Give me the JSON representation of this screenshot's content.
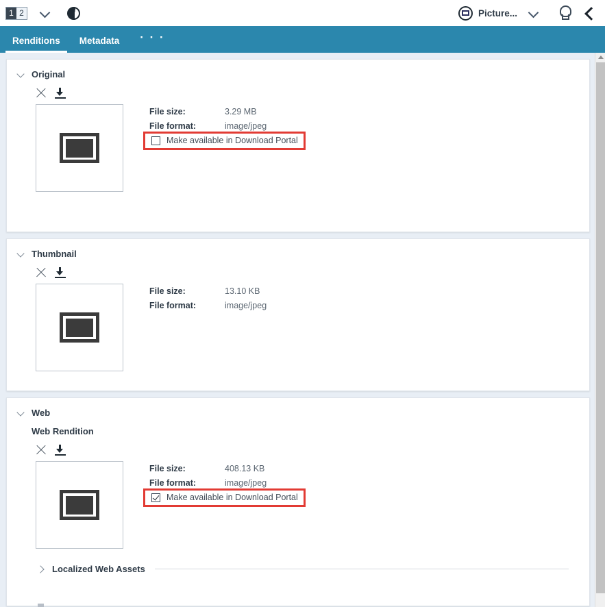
{
  "topbar": {
    "pager": {
      "pages": [
        "1",
        "2"
      ],
      "active_index": 0
    },
    "dropdown_icon": "chevron-down-icon",
    "globe_icon": "globe-icon",
    "asset_type": {
      "label": "Picture...",
      "icon": "picture-icon"
    },
    "help_icon": "lightbulb-icon",
    "collapse_icon": "chevron-left-icon"
  },
  "tabs": {
    "items": [
      {
        "label": "Renditions",
        "active": true
      },
      {
        "label": "Metadata",
        "active": false
      }
    ],
    "more_label": "· · ·"
  },
  "labels": {
    "file_size": "File size:",
    "file_format": "File format:",
    "download_portal": "Make available in Download Portal"
  },
  "sections": [
    {
      "title": "Original",
      "expanded": true,
      "file_size": "3.29 MB",
      "file_format": "image/jpeg",
      "has_checkbox": true,
      "checked": false,
      "highlighted": true
    },
    {
      "title": "Thumbnail",
      "expanded": true,
      "file_size": "13.10 KB",
      "file_format": "image/jpeg",
      "has_checkbox": false,
      "checked": false,
      "highlighted": false
    },
    {
      "title": "Web",
      "subtitle": "Web Rendition",
      "expanded": true,
      "file_size": "408.13 KB",
      "file_format": "image/jpeg",
      "has_checkbox": true,
      "checked": true,
      "highlighted": true,
      "collapsed_child": {
        "title": "Localized Web Assets",
        "expanded": false
      }
    }
  ],
  "colors": {
    "tabbar": "#2b87ad",
    "page_background": "#e8eef5",
    "highlight": "#e23b34",
    "text": "#2f3b47"
  }
}
